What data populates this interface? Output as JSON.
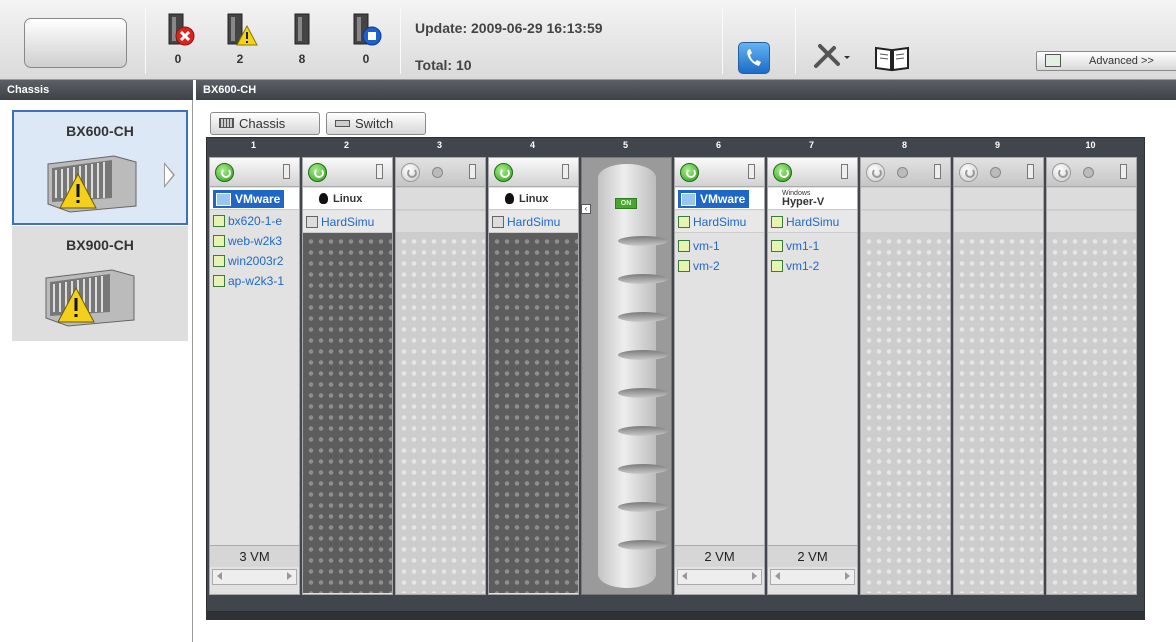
{
  "toolbar": {
    "status_counts": [
      {
        "icon": "server-error-icon",
        "count": "0"
      },
      {
        "icon": "server-warning-icon",
        "count": "2"
      },
      {
        "icon": "server-normal-icon",
        "count": "8"
      },
      {
        "icon": "server-stopped-icon",
        "count": "0"
      }
    ],
    "update_text": "Update: 2009-06-29 16:13:59",
    "total_text": "Total: 10",
    "advanced_label": "Advanced >>"
  },
  "sidebar": {
    "header": "Chassis",
    "items": [
      {
        "name": "BX600-CH",
        "status": "warning",
        "selected": true
      },
      {
        "name": "BX900-CH",
        "status": "warning",
        "selected": false
      }
    ]
  },
  "main": {
    "header": "BX600-CH",
    "view_buttons": {
      "chassis": "Chassis",
      "switch": "Switch"
    },
    "slots": [
      {
        "num": "1",
        "type": "blade",
        "power": "on",
        "os": "VMware",
        "host": "bx620-1-e",
        "vms": [
          "web-w2k3",
          "win2003r2",
          "ap-w2k3-1"
        ],
        "vm_count": "3 VM"
      },
      {
        "num": "2",
        "type": "blade",
        "power": "on",
        "os": "Linux",
        "host": "HardSimu"
      },
      {
        "num": "3",
        "type": "empty",
        "power": "off"
      },
      {
        "num": "4",
        "type": "blade",
        "power": "on",
        "os": "Linux",
        "host": "HardSimu"
      },
      {
        "num": "5",
        "type": "switch",
        "state": "ON"
      },
      {
        "num": "6",
        "type": "blade",
        "power": "on",
        "os": "VMware",
        "host": "HardSimu",
        "vms": [
          "vm-1",
          "vm-2"
        ],
        "vm_count": "2 VM"
      },
      {
        "num": "7",
        "type": "blade",
        "power": "on",
        "os": "Hyper-V",
        "os_small": "Windows",
        "host": "HardSimu",
        "vms": [
          "vm1-1",
          "vm1-2"
        ],
        "vm_count": "2 VM"
      },
      {
        "num": "8",
        "type": "empty",
        "power": "off"
      },
      {
        "num": "9",
        "type": "empty",
        "power": "off"
      },
      {
        "num": "10",
        "type": "empty",
        "power": "off"
      }
    ]
  },
  "colors": {
    "accent": "#1f67c7",
    "link": "#2168c8",
    "header_bg": "#4a4e53",
    "power_on": "#2d9a1a"
  }
}
